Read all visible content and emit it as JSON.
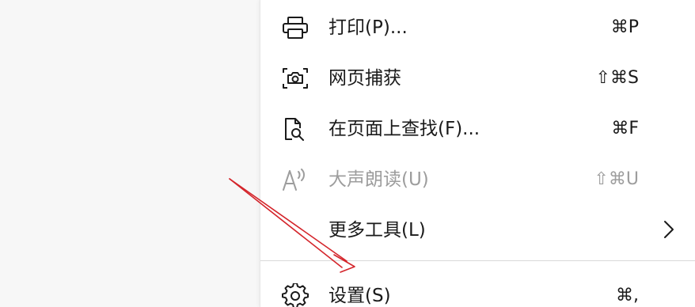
{
  "menu": {
    "items": [
      {
        "label": "打印(P)...",
        "shortcut": "⌘P",
        "icon": "printer-icon",
        "enabled": true
      },
      {
        "label": "网页捕获",
        "shortcut": "⇧⌘S",
        "icon": "camera-capture-icon",
        "enabled": true
      },
      {
        "label": "在页面上查找(F)...",
        "shortcut": "⌘F",
        "icon": "find-in-page-icon",
        "enabled": true
      },
      {
        "label": "大声朗读(U)",
        "shortcut": "⇧⌘U",
        "icon": "read-aloud-icon",
        "enabled": false
      },
      {
        "label": "更多工具(L)",
        "shortcut": "",
        "icon": "chevron-right-icon",
        "enabled": true
      },
      {
        "label": "设置(S)",
        "shortcut": "⌘,",
        "icon": "gear-icon",
        "enabled": true
      }
    ]
  },
  "annotation": {
    "arrow_color": "#d4252b"
  }
}
